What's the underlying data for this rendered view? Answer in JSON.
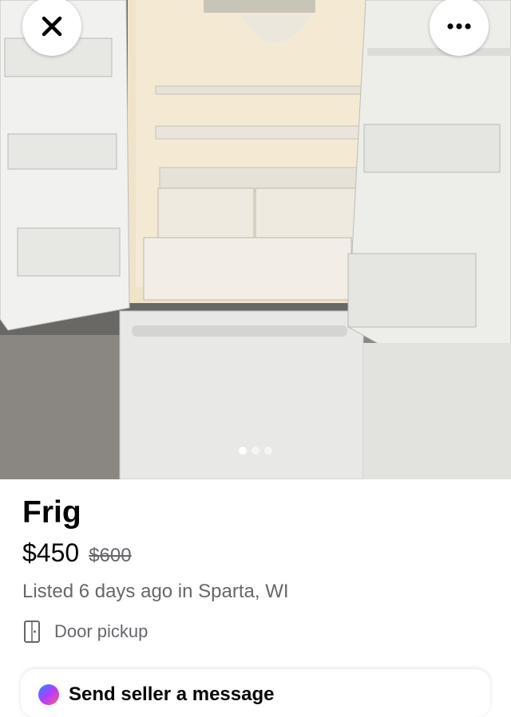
{
  "listing": {
    "title": "Frig",
    "price": "$450",
    "original_price": "$600",
    "listed_text": "Listed 6 days ago in Sparta, WI",
    "delivery": "Door pickup"
  },
  "photo": {
    "description_icon": "refrigerator-photo",
    "carousel_total": 3,
    "carousel_active": 1
  },
  "actions": {
    "close_icon": "close-icon",
    "more_icon": "more-icon",
    "send_message_label": "Send seller a message"
  },
  "colors": {
    "text_primary": "#050505",
    "text_secondary": "#65676b",
    "background": "#ffffff"
  }
}
